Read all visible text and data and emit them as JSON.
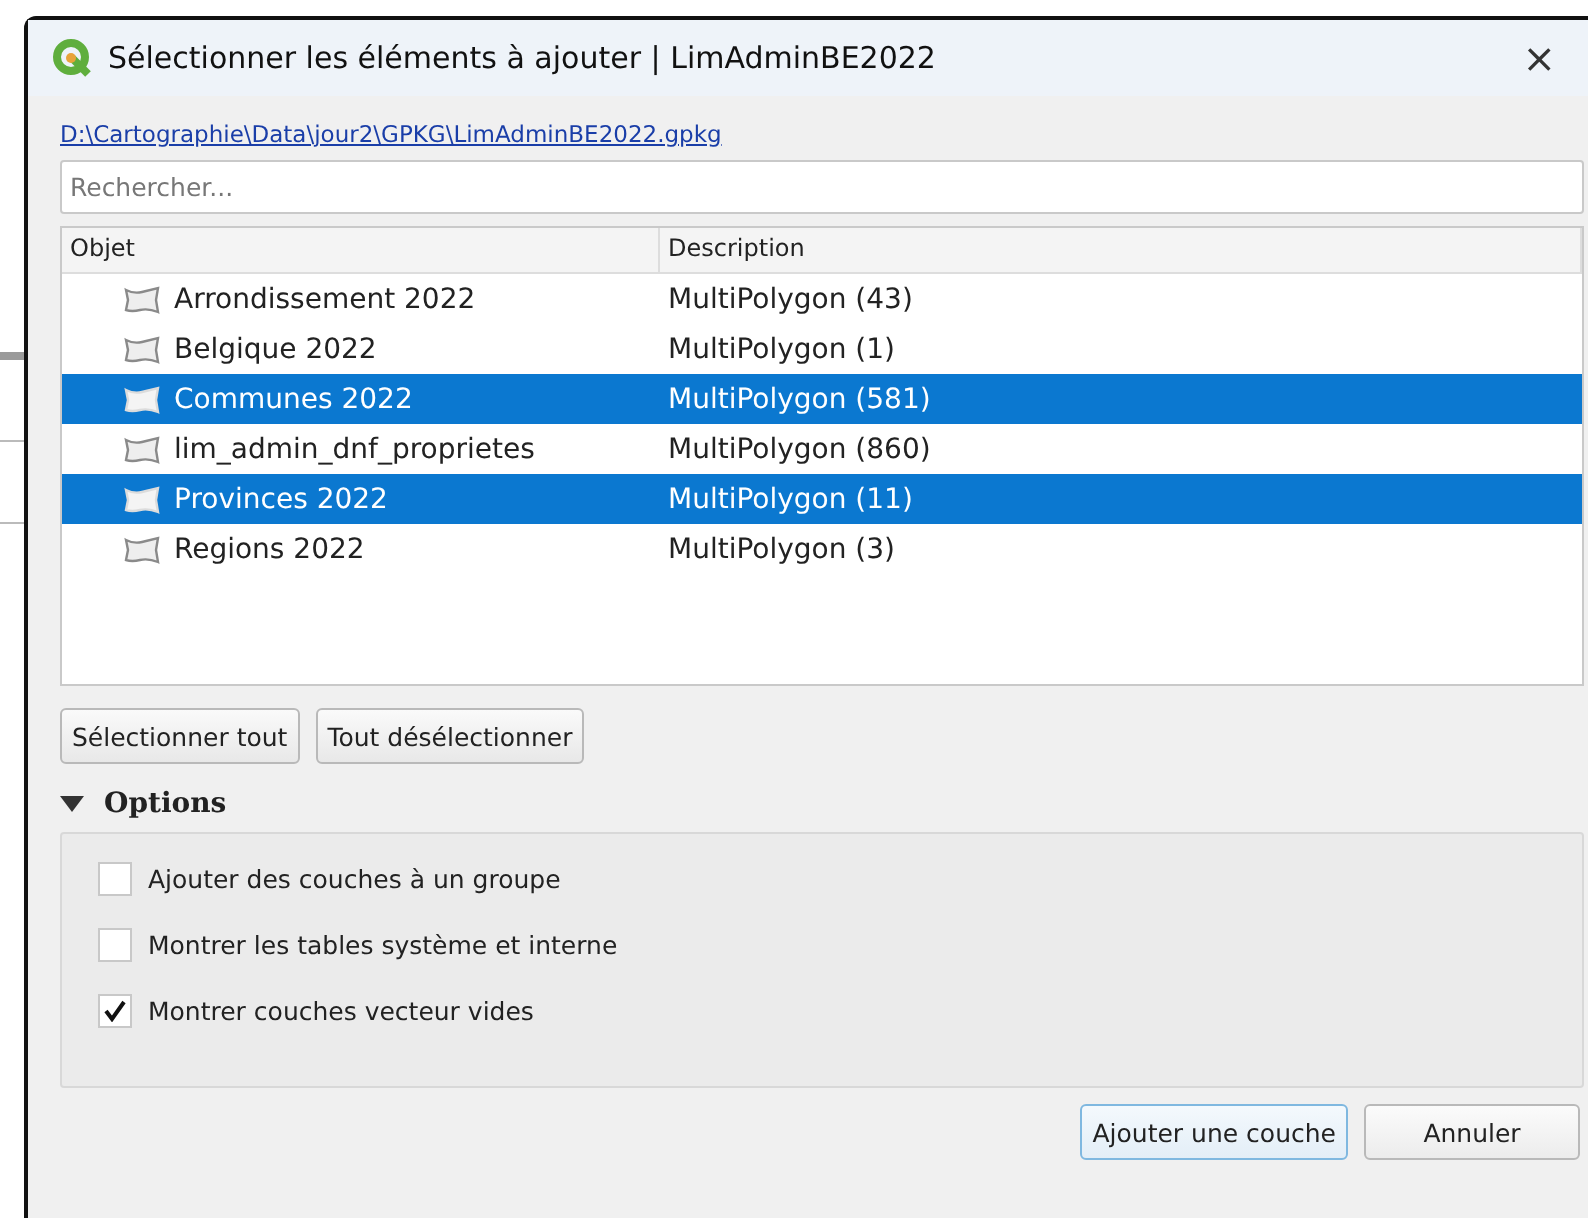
{
  "window": {
    "title": "Sélectionner les éléments à ajouter | LimAdminBE2022",
    "close": "×"
  },
  "path_link": "D:\\Cartographie\\Data\\jour2\\GPKG\\LimAdminBE2022.gpkg",
  "search": {
    "placeholder": "Rechercher..."
  },
  "table": {
    "columns": [
      "Objet",
      "Description"
    ],
    "rows": [
      {
        "name": "Arrondissement 2022",
        "description": "MultiPolygon (43)",
        "selected": false
      },
      {
        "name": "Belgique 2022",
        "description": "MultiPolygon (1)",
        "selected": false
      },
      {
        "name": "Communes 2022",
        "description": "MultiPolygon (581)",
        "selected": true
      },
      {
        "name": "lim_admin_dnf_proprietes",
        "description": "MultiPolygon (860)",
        "selected": false
      },
      {
        "name": "Provinces 2022",
        "description": "MultiPolygon (11)",
        "selected": true
      },
      {
        "name": "Regions 2022",
        "description": "MultiPolygon (3)",
        "selected": false
      }
    ]
  },
  "selection_buttons": [
    "Sélectionner tout",
    "Tout désélectionner"
  ],
  "options": {
    "title": "Options",
    "expanded": true,
    "items": [
      {
        "label": "Ajouter des couches à un groupe",
        "checked": false
      },
      {
        "label": "Montrer les tables système et interne",
        "checked": false
      },
      {
        "label": "Montrer couches vecteur vides",
        "checked": true
      }
    ]
  },
  "buttons": [
    {
      "label": "Ajouter une couche",
      "kind": "default"
    },
    {
      "label": "Annuler",
      "kind": "normal"
    }
  ]
}
